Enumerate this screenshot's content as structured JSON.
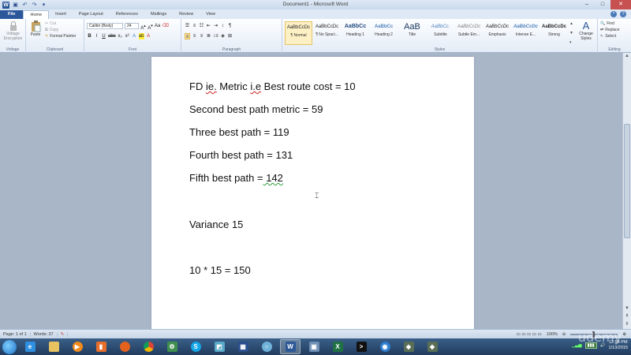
{
  "window": {
    "title": "Document1 - Microsoft Word",
    "minimize": "–",
    "maximize": "□",
    "close": "✕"
  },
  "tabs": [
    "File",
    "Home",
    "Insert",
    "Page Layout",
    "References",
    "Mailings",
    "Review",
    "View"
  ],
  "ribbon": {
    "voltage": {
      "button": "Voltage Encryption",
      "label": "Voltage"
    },
    "clipboard": {
      "paste": "Paste",
      "cut": "Cut",
      "copy": "Copy",
      "format_painter": "Format Painter",
      "label": "Clipboard"
    },
    "font": {
      "name": "Calibri (Body)",
      "size": "24",
      "label": "Font"
    },
    "paragraph": {
      "label": "Paragraph"
    },
    "styles": {
      "label": "Styles",
      "items": [
        {
          "sample": "AaBbCcDc",
          "name": "¶ Normal"
        },
        {
          "sample": "AaBbCcDc",
          "name": "¶ No Spaci..."
        },
        {
          "sample": "AaBbCc",
          "name": "Heading 1"
        },
        {
          "sample": "AaBbCc",
          "name": "Heading 2"
        },
        {
          "sample": "AaB",
          "name": "Title"
        },
        {
          "sample": "AaBbCc.",
          "name": "Subtitle"
        },
        {
          "sample": "AaBbCcDc",
          "name": "Subtle Em..."
        },
        {
          "sample": "AaBbCcDc",
          "name": "Emphasis"
        },
        {
          "sample": "AaBbCcDc",
          "name": "Intense E..."
        },
        {
          "sample": "AaBbCcDc",
          "name": "Strong"
        }
      ],
      "change_styles": "Change Styles"
    },
    "editing": {
      "find": "Find",
      "replace": "Replace",
      "select": "Select",
      "label": "Editing"
    }
  },
  "document": {
    "lines": [
      {
        "pre": "FD ",
        "sq1": "ie.",
        "mid": " Metric ",
        "sq2": "i.e",
        "post": " Best route cost = 10"
      },
      {
        "text": "Second best path metric = 59"
      },
      {
        "text": "Three best path = 119"
      },
      {
        "text": "Fourth best path = 131"
      },
      {
        "pre": "Fifth best path =",
        "sq1": "  142"
      },
      {
        "text": "Variance 15"
      },
      {
        "text": "10 * 15 = 150"
      }
    ]
  },
  "status": {
    "page": "Page: 1 of 1",
    "words": "Words: 37",
    "zoom": "100%"
  },
  "taskbar": {
    "clock_time": "12:54 PM",
    "clock_date": "1/13/2015"
  },
  "watermark": "udemy"
}
